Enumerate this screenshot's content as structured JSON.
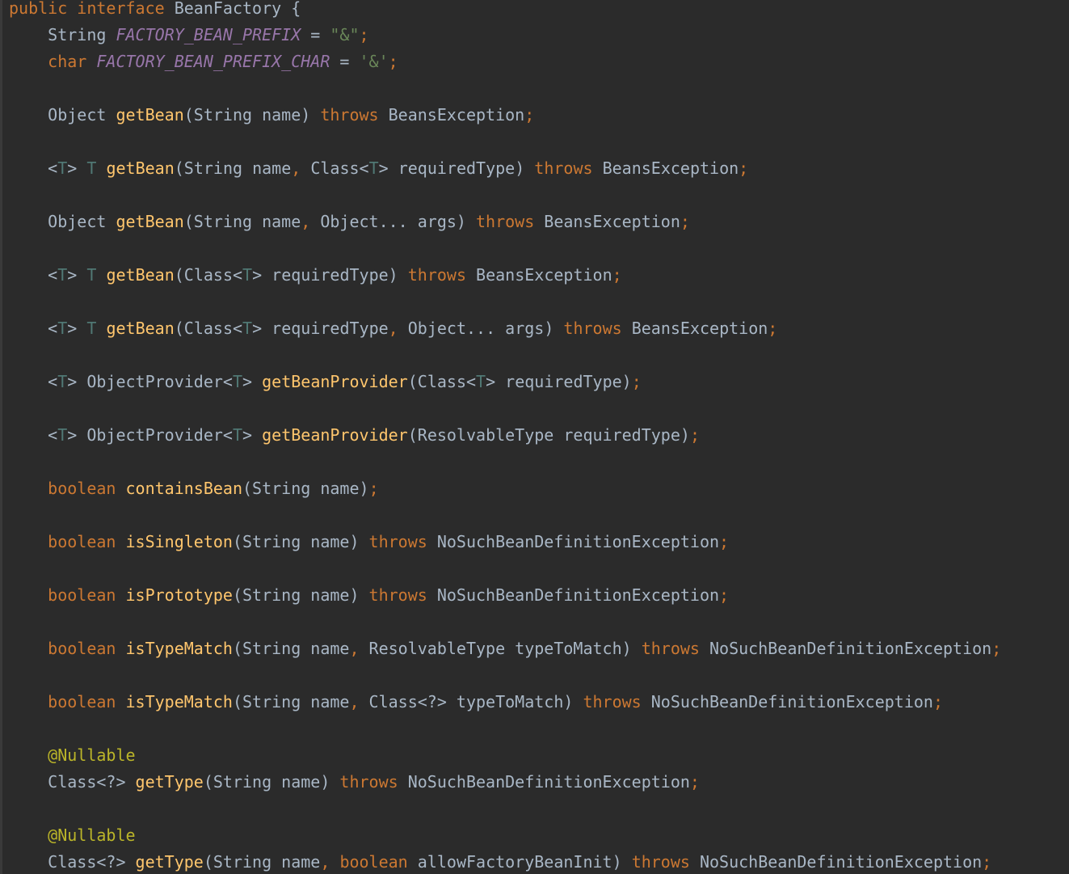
{
  "colors": {
    "background": "#2b2b2b",
    "keyword": "#cc7832",
    "method_name": "#ffc66d",
    "constant_field": "#9876aa",
    "string": "#6a8759",
    "type_parameter": "#507874",
    "annotation": "#bbb529",
    "plain_text": "#a9b7c6"
  },
  "code": {
    "lines": [
      [
        [
          "kw",
          "public"
        ],
        [
          "pl",
          " "
        ],
        [
          "kw",
          "interface"
        ],
        [
          "pl",
          " BeanFactory {"
        ]
      ],
      [
        [
          "pl",
          "    String "
        ],
        [
          "field",
          "FACTORY_BEAN_PREFIX"
        ],
        [
          "pl",
          " = "
        ],
        [
          "str",
          "\"&\""
        ],
        [
          "kw",
          ";"
        ]
      ],
      [
        [
          "pl",
          "    "
        ],
        [
          "kw",
          "char"
        ],
        [
          "pl",
          " "
        ],
        [
          "field",
          "FACTORY_BEAN_PREFIX_CHAR"
        ],
        [
          "pl",
          " = "
        ],
        [
          "str",
          "'&'"
        ],
        [
          "kw",
          ";"
        ]
      ],
      [],
      [
        [
          "pl",
          "    Object "
        ],
        [
          "fn",
          "getBean"
        ],
        [
          "pl",
          "(String name) "
        ],
        [
          "kw",
          "throws"
        ],
        [
          "pl",
          " BeansException"
        ],
        [
          "kw",
          ";"
        ]
      ],
      [],
      [
        [
          "pl",
          "    <"
        ],
        [
          "tp",
          "T"
        ],
        [
          "pl",
          "> "
        ],
        [
          "tp",
          "T"
        ],
        [
          "pl",
          " "
        ],
        [
          "fn",
          "getBean"
        ],
        [
          "pl",
          "(String name"
        ],
        [
          "kw",
          ","
        ],
        [
          "pl",
          " Class<"
        ],
        [
          "tp",
          "T"
        ],
        [
          "pl",
          "> requiredType) "
        ],
        [
          "kw",
          "throws"
        ],
        [
          "pl",
          " BeansException"
        ],
        [
          "kw",
          ";"
        ]
      ],
      [],
      [
        [
          "pl",
          "    Object "
        ],
        [
          "fn",
          "getBean"
        ],
        [
          "pl",
          "(String name"
        ],
        [
          "kw",
          ","
        ],
        [
          "pl",
          " Object... args) "
        ],
        [
          "kw",
          "throws"
        ],
        [
          "pl",
          " BeansException"
        ],
        [
          "kw",
          ";"
        ]
      ],
      [],
      [
        [
          "pl",
          "    <"
        ],
        [
          "tp",
          "T"
        ],
        [
          "pl",
          "> "
        ],
        [
          "tp",
          "T"
        ],
        [
          "pl",
          " "
        ],
        [
          "fn",
          "getBean"
        ],
        [
          "pl",
          "(Class<"
        ],
        [
          "tp",
          "T"
        ],
        [
          "pl",
          "> requiredType) "
        ],
        [
          "kw",
          "throws"
        ],
        [
          "pl",
          " BeansException"
        ],
        [
          "kw",
          ";"
        ]
      ],
      [],
      [
        [
          "pl",
          "    <"
        ],
        [
          "tp",
          "T"
        ],
        [
          "pl",
          "> "
        ],
        [
          "tp",
          "T"
        ],
        [
          "pl",
          " "
        ],
        [
          "fn",
          "getBean"
        ],
        [
          "pl",
          "(Class<"
        ],
        [
          "tp",
          "T"
        ],
        [
          "pl",
          "> requiredType"
        ],
        [
          "kw",
          ","
        ],
        [
          "pl",
          " Object... args) "
        ],
        [
          "kw",
          "throws"
        ],
        [
          "pl",
          " BeansException"
        ],
        [
          "kw",
          ";"
        ]
      ],
      [],
      [
        [
          "pl",
          "    <"
        ],
        [
          "tp",
          "T"
        ],
        [
          "pl",
          "> ObjectProvider<"
        ],
        [
          "tp",
          "T"
        ],
        [
          "pl",
          "> "
        ],
        [
          "fn",
          "getBeanProvider"
        ],
        [
          "pl",
          "(Class<"
        ],
        [
          "tp",
          "T"
        ],
        [
          "pl",
          "> requiredType)"
        ],
        [
          "kw",
          ";"
        ]
      ],
      [],
      [
        [
          "pl",
          "    <"
        ],
        [
          "tp",
          "T"
        ],
        [
          "pl",
          "> ObjectProvider<"
        ],
        [
          "tp",
          "T"
        ],
        [
          "pl",
          "> "
        ],
        [
          "fn",
          "getBeanProvider"
        ],
        [
          "pl",
          "(ResolvableType requiredType)"
        ],
        [
          "kw",
          ";"
        ]
      ],
      [],
      [
        [
          "pl",
          "    "
        ],
        [
          "kw",
          "boolean"
        ],
        [
          "pl",
          " "
        ],
        [
          "fn",
          "containsBean"
        ],
        [
          "pl",
          "(String name)"
        ],
        [
          "kw",
          ";"
        ]
      ],
      [],
      [
        [
          "pl",
          "    "
        ],
        [
          "kw",
          "boolean"
        ],
        [
          "pl",
          " "
        ],
        [
          "fn",
          "isSingleton"
        ],
        [
          "pl",
          "(String name) "
        ],
        [
          "kw",
          "throws"
        ],
        [
          "pl",
          " NoSuchBeanDefinitionException"
        ],
        [
          "kw",
          ";"
        ]
      ],
      [],
      [
        [
          "pl",
          "    "
        ],
        [
          "kw",
          "boolean"
        ],
        [
          "pl",
          " "
        ],
        [
          "fn",
          "isPrototype"
        ],
        [
          "pl",
          "(String name) "
        ],
        [
          "kw",
          "throws"
        ],
        [
          "pl",
          " NoSuchBeanDefinitionException"
        ],
        [
          "kw",
          ";"
        ]
      ],
      [],
      [
        [
          "pl",
          "    "
        ],
        [
          "kw",
          "boolean"
        ],
        [
          "pl",
          " "
        ],
        [
          "fn",
          "isTypeMatch"
        ],
        [
          "pl",
          "(String name"
        ],
        [
          "kw",
          ","
        ],
        [
          "pl",
          " ResolvableType typeToMatch) "
        ],
        [
          "kw",
          "throws"
        ],
        [
          "pl",
          " NoSuchBeanDefinitionException"
        ],
        [
          "kw",
          ";"
        ]
      ],
      [],
      [
        [
          "pl",
          "    "
        ],
        [
          "kw",
          "boolean"
        ],
        [
          "pl",
          " "
        ],
        [
          "fn",
          "isTypeMatch"
        ],
        [
          "pl",
          "(String name"
        ],
        [
          "kw",
          ","
        ],
        [
          "pl",
          " Class<?> typeToMatch) "
        ],
        [
          "kw",
          "throws"
        ],
        [
          "pl",
          " NoSuchBeanDefinitionException"
        ],
        [
          "kw",
          ";"
        ]
      ],
      [],
      [
        [
          "pl",
          "    "
        ],
        [
          "ann",
          "@Nullable"
        ]
      ],
      [
        [
          "pl",
          "    Class<?> "
        ],
        [
          "fn",
          "getType"
        ],
        [
          "pl",
          "(String name) "
        ],
        [
          "kw",
          "throws"
        ],
        [
          "pl",
          " NoSuchBeanDefinitionException"
        ],
        [
          "kw",
          ";"
        ]
      ],
      [],
      [
        [
          "pl",
          "    "
        ],
        [
          "ann",
          "@Nullable"
        ]
      ],
      [
        [
          "pl",
          "    Class<?> "
        ],
        [
          "fn",
          "getType"
        ],
        [
          "pl",
          "(String name"
        ],
        [
          "kw",
          ","
        ],
        [
          "pl",
          " "
        ],
        [
          "kw",
          "boolean"
        ],
        [
          "pl",
          " allowFactoryBeanInit) "
        ],
        [
          "kw",
          "throws"
        ],
        [
          "pl",
          " NoSuchBeanDefinitionException"
        ],
        [
          "kw",
          ";"
        ]
      ]
    ]
  }
}
